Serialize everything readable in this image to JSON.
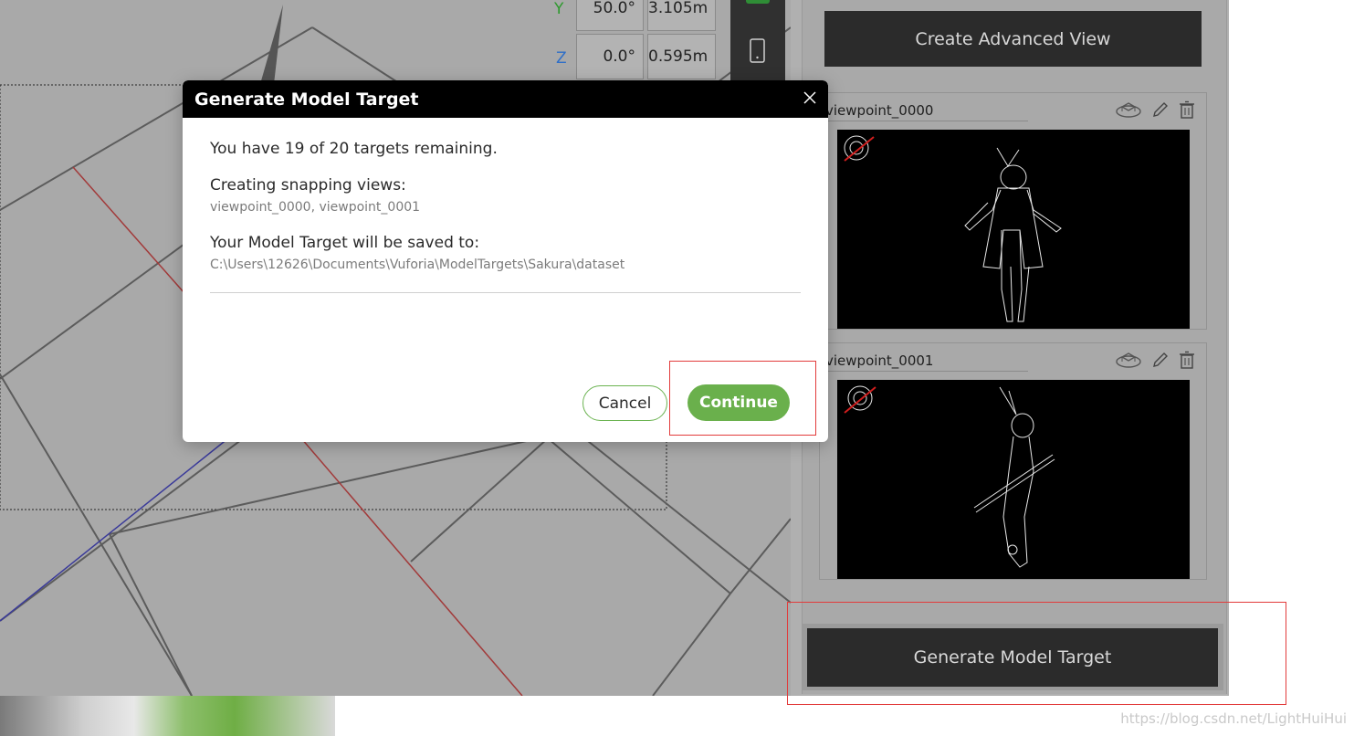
{
  "coordinates": {
    "y": {
      "axis": "Y",
      "angle": "50.0°",
      "distance": "3.105m"
    },
    "z": {
      "axis": "Z",
      "angle": "0.0°",
      "distance": "0.595m"
    }
  },
  "right_panel": {
    "create_button": "Create Advanced View",
    "viewpoints": [
      {
        "name": "viewpoint_0000"
      },
      {
        "name": "viewpoint_0001"
      }
    ],
    "generate_button": "Generate Model Target"
  },
  "modal": {
    "title": "Generate Model Target",
    "remaining": "You have 19 of 20 targets remaining.",
    "snapping_heading": "Creating snapping views:",
    "snapping_views": "viewpoint_0000, viewpoint_0001",
    "save_heading": "Your Model Target will be saved to:",
    "save_path": "C:\\Users\\12626\\Documents\\Vuforia\\ModelTargets\\Sakura\\dataset",
    "cancel_label": "Cancel",
    "continue_label": "Continue"
  },
  "watermark": "https://blog.csdn.net/LightHuiHui",
  "colors": {
    "accent_green": "#6ab04c",
    "y_axis": "#2e9a2e",
    "z_axis": "#2f6fc8",
    "highlight_red": "#e23b3b"
  }
}
